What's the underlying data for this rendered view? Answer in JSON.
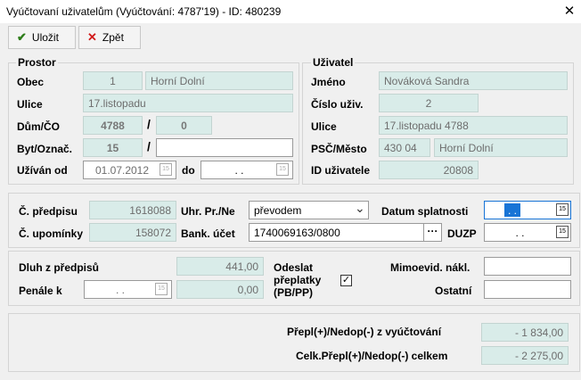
{
  "window": {
    "title": "Vyúčtovaní uživatelům (Vyúčtování: 4787'19) - ID: 480239",
    "close_glyph": "✕"
  },
  "toolbar": {
    "save_label": "Uložit",
    "back_label": "Zpět"
  },
  "prostor": {
    "title": "Prostor",
    "obec_label": "Obec",
    "obec_code": "1",
    "obec_name": "Horní Dolní",
    "ulice_label": "Ulice",
    "ulice_value": "17.listopadu",
    "dum_label": "Dům/ČO",
    "dum_value": "4788",
    "co_value": "0",
    "byt_label": "Byt/Označ.",
    "byt_value": "15",
    "oznac_value": "",
    "uzivan_label": "Užíván od",
    "uzivan_od": "01.07.2012",
    "do_label": "do",
    "uzivan_do": ". ."
  },
  "uzivatel": {
    "title": "Uživatel",
    "jmeno_label": "Jméno",
    "jmeno_value": "Nováková Sandra",
    "cislo_label": "Číslo uživ.",
    "cislo_value": "2",
    "ulice_label": "Ulice",
    "ulice_value": "17.listopadu 4788",
    "psc_label": "PSČ/Město",
    "psc_value": "430 04",
    "mesto_value": "Horní Dolní",
    "id_label": "ID uživatele",
    "id_value": "20808"
  },
  "payment": {
    "predpis_label": "Č. předpisu",
    "predpis_value": "1618088",
    "upominky_label": "Č. upomínky",
    "upominky_value": "158072",
    "uhr_label": "Uhr. Pr./Ne",
    "uhr_value": "převodem",
    "bank_label": "Bank. účet",
    "bank_value": "1740069163/0800",
    "splatnost_label": "Datum splatnosti",
    "splatnost_value": ". .",
    "duzp_label": "DUZP",
    "duzp_value": ". ."
  },
  "debt": {
    "dluh_label": "Dluh z předpisů",
    "dluh_value": "441,00",
    "penale_label": "Penále k",
    "penale_date": ". .",
    "penale_value": "0,00",
    "odeslat_label_1": "Odeslat",
    "odeslat_label_2": "přeplatky",
    "odeslat_label_3": "(PB/PP)",
    "odeslat_checked": "✓",
    "mimoevid_label": "Mimoevid. nákl.",
    "mimoevid_value": "",
    "ostatni_label": "Ostatní",
    "ostatni_value": ""
  },
  "summary": {
    "vyuct_label": "Přepl(+)/Nedop(-) z vyúčtování",
    "vyuct_value": "- 1 834,00",
    "celk_label": "Celk.Přepl(+)/Nedop(-) celkem",
    "celk_value": "- 2 275,00"
  },
  "icons": {
    "calendar": "15",
    "dropdown": "⌄",
    "ellipsis": "···"
  },
  "colors": {
    "readonly_bg": "#d9ece9",
    "highlight": "#1874d6",
    "save_icon": "#2e7d1a",
    "back_icon": "#d11a1a"
  }
}
